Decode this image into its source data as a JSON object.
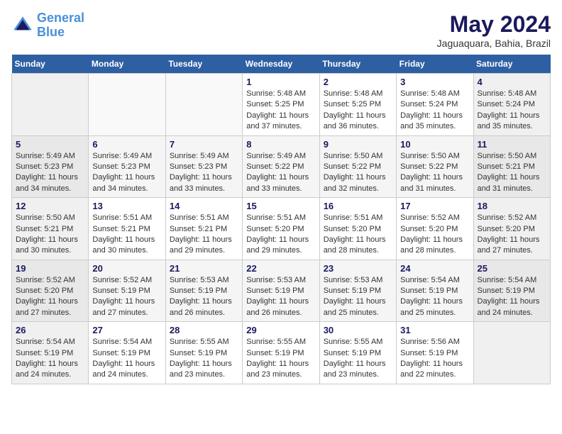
{
  "logo": {
    "line1": "General",
    "line2": "Blue"
  },
  "title": "May 2024",
  "location": "Jaguaquara, Bahia, Brazil",
  "days_of_week": [
    "Sunday",
    "Monday",
    "Tuesday",
    "Wednesday",
    "Thursday",
    "Friday",
    "Saturday"
  ],
  "weeks": [
    [
      {
        "num": "",
        "sunrise": "",
        "sunset": "",
        "daylight": ""
      },
      {
        "num": "",
        "sunrise": "",
        "sunset": "",
        "daylight": ""
      },
      {
        "num": "",
        "sunrise": "",
        "sunset": "",
        "daylight": ""
      },
      {
        "num": "1",
        "sunrise": "Sunrise: 5:48 AM",
        "sunset": "Sunset: 5:25 PM",
        "daylight": "Daylight: 11 hours and 37 minutes."
      },
      {
        "num": "2",
        "sunrise": "Sunrise: 5:48 AM",
        "sunset": "Sunset: 5:25 PM",
        "daylight": "Daylight: 11 hours and 36 minutes."
      },
      {
        "num": "3",
        "sunrise": "Sunrise: 5:48 AM",
        "sunset": "Sunset: 5:24 PM",
        "daylight": "Daylight: 11 hours and 35 minutes."
      },
      {
        "num": "4",
        "sunrise": "Sunrise: 5:48 AM",
        "sunset": "Sunset: 5:24 PM",
        "daylight": "Daylight: 11 hours and 35 minutes."
      }
    ],
    [
      {
        "num": "5",
        "sunrise": "Sunrise: 5:49 AM",
        "sunset": "Sunset: 5:23 PM",
        "daylight": "Daylight: 11 hours and 34 minutes."
      },
      {
        "num": "6",
        "sunrise": "Sunrise: 5:49 AM",
        "sunset": "Sunset: 5:23 PM",
        "daylight": "Daylight: 11 hours and 34 minutes."
      },
      {
        "num": "7",
        "sunrise": "Sunrise: 5:49 AM",
        "sunset": "Sunset: 5:23 PM",
        "daylight": "Daylight: 11 hours and 33 minutes."
      },
      {
        "num": "8",
        "sunrise": "Sunrise: 5:49 AM",
        "sunset": "Sunset: 5:22 PM",
        "daylight": "Daylight: 11 hours and 33 minutes."
      },
      {
        "num": "9",
        "sunrise": "Sunrise: 5:50 AM",
        "sunset": "Sunset: 5:22 PM",
        "daylight": "Daylight: 11 hours and 32 minutes."
      },
      {
        "num": "10",
        "sunrise": "Sunrise: 5:50 AM",
        "sunset": "Sunset: 5:22 PM",
        "daylight": "Daylight: 11 hours and 31 minutes."
      },
      {
        "num": "11",
        "sunrise": "Sunrise: 5:50 AM",
        "sunset": "Sunset: 5:21 PM",
        "daylight": "Daylight: 11 hours and 31 minutes."
      }
    ],
    [
      {
        "num": "12",
        "sunrise": "Sunrise: 5:50 AM",
        "sunset": "Sunset: 5:21 PM",
        "daylight": "Daylight: 11 hours and 30 minutes."
      },
      {
        "num": "13",
        "sunrise": "Sunrise: 5:51 AM",
        "sunset": "Sunset: 5:21 PM",
        "daylight": "Daylight: 11 hours and 30 minutes."
      },
      {
        "num": "14",
        "sunrise": "Sunrise: 5:51 AM",
        "sunset": "Sunset: 5:21 PM",
        "daylight": "Daylight: 11 hours and 29 minutes."
      },
      {
        "num": "15",
        "sunrise": "Sunrise: 5:51 AM",
        "sunset": "Sunset: 5:20 PM",
        "daylight": "Daylight: 11 hours and 29 minutes."
      },
      {
        "num": "16",
        "sunrise": "Sunrise: 5:51 AM",
        "sunset": "Sunset: 5:20 PM",
        "daylight": "Daylight: 11 hours and 28 minutes."
      },
      {
        "num": "17",
        "sunrise": "Sunrise: 5:52 AM",
        "sunset": "Sunset: 5:20 PM",
        "daylight": "Daylight: 11 hours and 28 minutes."
      },
      {
        "num": "18",
        "sunrise": "Sunrise: 5:52 AM",
        "sunset": "Sunset: 5:20 PM",
        "daylight": "Daylight: 11 hours and 27 minutes."
      }
    ],
    [
      {
        "num": "19",
        "sunrise": "Sunrise: 5:52 AM",
        "sunset": "Sunset: 5:20 PM",
        "daylight": "Daylight: 11 hours and 27 minutes."
      },
      {
        "num": "20",
        "sunrise": "Sunrise: 5:52 AM",
        "sunset": "Sunset: 5:19 PM",
        "daylight": "Daylight: 11 hours and 27 minutes."
      },
      {
        "num": "21",
        "sunrise": "Sunrise: 5:53 AM",
        "sunset": "Sunset: 5:19 PM",
        "daylight": "Daylight: 11 hours and 26 minutes."
      },
      {
        "num": "22",
        "sunrise": "Sunrise: 5:53 AM",
        "sunset": "Sunset: 5:19 PM",
        "daylight": "Daylight: 11 hours and 26 minutes."
      },
      {
        "num": "23",
        "sunrise": "Sunrise: 5:53 AM",
        "sunset": "Sunset: 5:19 PM",
        "daylight": "Daylight: 11 hours and 25 minutes."
      },
      {
        "num": "24",
        "sunrise": "Sunrise: 5:54 AM",
        "sunset": "Sunset: 5:19 PM",
        "daylight": "Daylight: 11 hours and 25 minutes."
      },
      {
        "num": "25",
        "sunrise": "Sunrise: 5:54 AM",
        "sunset": "Sunset: 5:19 PM",
        "daylight": "Daylight: 11 hours and 24 minutes."
      }
    ],
    [
      {
        "num": "26",
        "sunrise": "Sunrise: 5:54 AM",
        "sunset": "Sunset: 5:19 PM",
        "daylight": "Daylight: 11 hours and 24 minutes."
      },
      {
        "num": "27",
        "sunrise": "Sunrise: 5:54 AM",
        "sunset": "Sunset: 5:19 PM",
        "daylight": "Daylight: 11 hours and 24 minutes."
      },
      {
        "num": "28",
        "sunrise": "Sunrise: 5:55 AM",
        "sunset": "Sunset: 5:19 PM",
        "daylight": "Daylight: 11 hours and 23 minutes."
      },
      {
        "num": "29",
        "sunrise": "Sunrise: 5:55 AM",
        "sunset": "Sunset: 5:19 PM",
        "daylight": "Daylight: 11 hours and 23 minutes."
      },
      {
        "num": "30",
        "sunrise": "Sunrise: 5:55 AM",
        "sunset": "Sunset: 5:19 PM",
        "daylight": "Daylight: 11 hours and 23 minutes."
      },
      {
        "num": "31",
        "sunrise": "Sunrise: 5:56 AM",
        "sunset": "Sunset: 5:19 PM",
        "daylight": "Daylight: 11 hours and 22 minutes."
      },
      {
        "num": "",
        "sunrise": "",
        "sunset": "",
        "daylight": ""
      }
    ]
  ]
}
